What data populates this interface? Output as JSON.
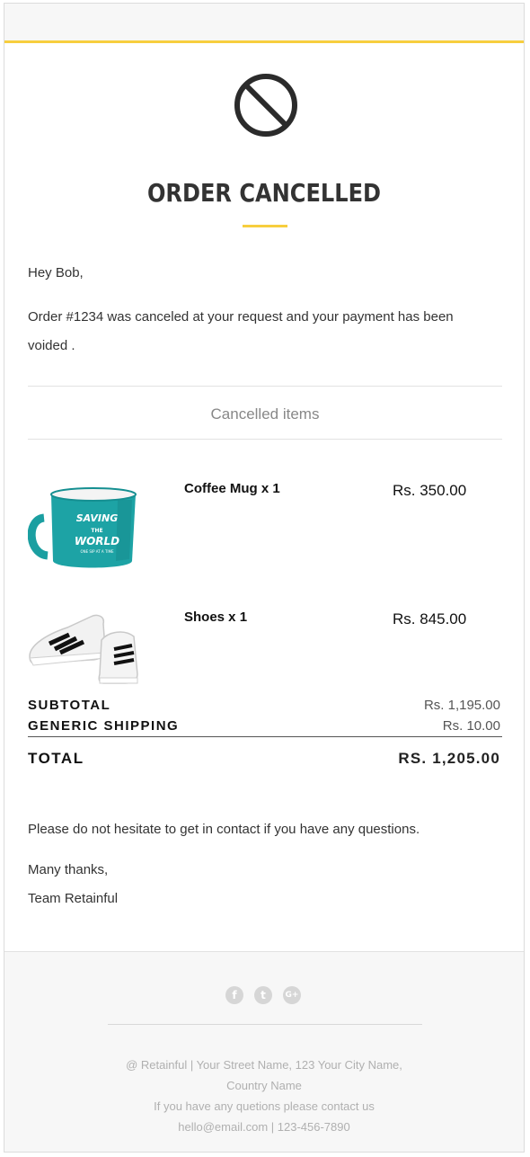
{
  "title": "ORDER CANCELLED",
  "greeting": "Hey Bob,",
  "message": "Order #1234 was canceled at your request and your payment has been voided .",
  "section_title": "Cancelled items",
  "items": [
    {
      "name": "Coffee Mug x 1",
      "price": "Rs. 350.00",
      "image": "coffee-mug-image",
      "mug_text_1": "SAVING",
      "mug_text_2": "THE",
      "mug_text_3": "WORLD",
      "mug_text_4": "ONE SIP AT A TIME"
    },
    {
      "name": "Shoes x 1",
      "price": "Rs. 845.00",
      "image": "sneakers-image"
    }
  ],
  "summary": {
    "subtotal_label": "SUBTOTAL",
    "subtotal_value": "Rs. 1,195.00",
    "shipping_label": "GENERIC SHIPPING",
    "shipping_value": "Rs. 10.00",
    "total_label": "TOTAL",
    "total_value": "RS. 1,205.00"
  },
  "closing": {
    "contact_text": "Please do not hesitate to get in contact if you have any questions.",
    "thanks": "Many thanks,",
    "team": "Team Retainful"
  },
  "footer": {
    "social": [
      {
        "icon": "facebook-icon",
        "glyph": "f"
      },
      {
        "icon": "twitter-icon",
        "glyph": "t"
      },
      {
        "icon": "google-plus-icon",
        "glyph": "G+"
      }
    ],
    "address_line_1": "@ Retainful | Your Street Name, 123 Your City Name,",
    "address_line_2": "Country Name",
    "contact_line": "If you have any quetions please contact us",
    "contact_details": "hello@email.com | 123-456-7890"
  },
  "colors": {
    "accent": "#f7ce3e",
    "text": "#333333",
    "footer_bg": "#f7f7f7"
  }
}
